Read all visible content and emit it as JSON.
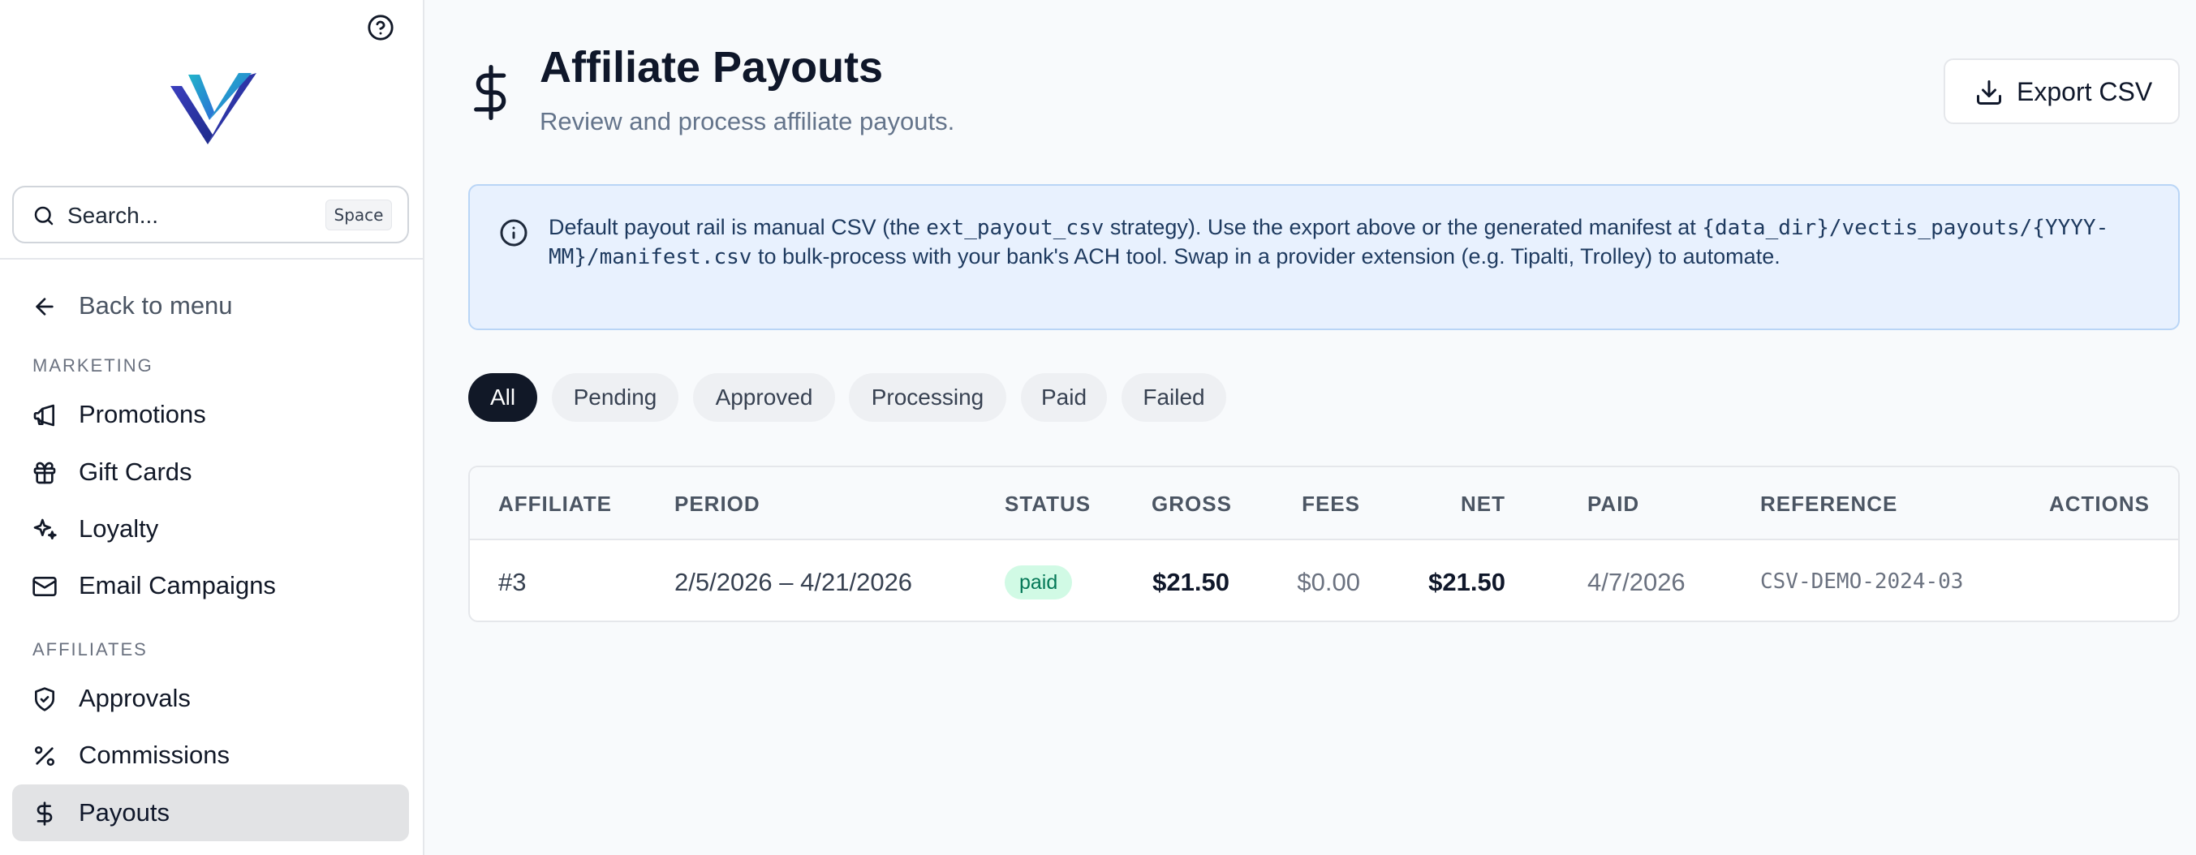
{
  "sidebar": {
    "search": {
      "placeholder": "Search...",
      "shortcut": "Space"
    },
    "back_label": "Back to menu",
    "sections": [
      {
        "label": "MARKETING",
        "items": [
          "Promotions",
          "Gift Cards",
          "Loyalty",
          "Email Campaigns"
        ]
      },
      {
        "label": "AFFILIATES",
        "items": [
          "Approvals",
          "Commissions",
          "Payouts"
        ]
      }
    ],
    "active_item": "Payouts"
  },
  "header": {
    "title": "Affiliate Payouts",
    "subtitle": "Review and process affiliate payouts.",
    "export_label": "Export CSV"
  },
  "info": {
    "t1": "Default payout rail is manual CSV (the ",
    "code1": "ext_payout_csv",
    "t2": " strategy). Use the export above or the generated manifest at ",
    "code2": "{data_dir}/vectis_payouts/{YYYY-MM}/manifest.csv",
    "t3": " to bulk-process with your bank's ACH tool. Swap in a provider extension (e.g. Tipalti, Trolley) to automate."
  },
  "filters": [
    "All",
    "Pending",
    "Approved",
    "Processing",
    "Paid",
    "Failed"
  ],
  "active_filter": "All",
  "table": {
    "columns": [
      "AFFILIATE",
      "PERIOD",
      "STATUS",
      "GROSS",
      "FEES",
      "NET",
      "PAID",
      "REFERENCE",
      "ACTIONS"
    ],
    "rows": [
      {
        "affiliate": "#3",
        "period": "2/5/2026 – 4/21/2026",
        "status": "paid",
        "gross": "$21.50",
        "fees": "$0.00",
        "net": "$21.50",
        "paid": "4/7/2026",
        "reference": "CSV-DEMO-2024-03"
      }
    ]
  },
  "colors": {
    "accent_dark": "#111827",
    "info_bg": "#e8f1fe",
    "status_paid_bg": "#d1fae5",
    "status_paid_text": "#047857"
  }
}
